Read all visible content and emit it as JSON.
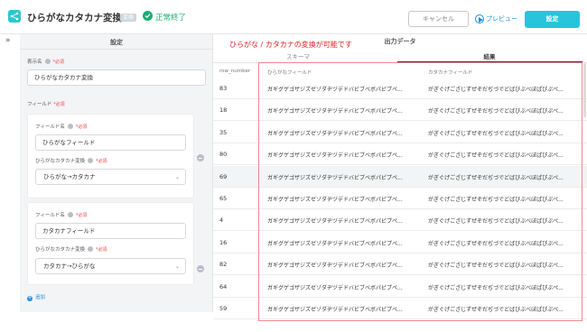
{
  "header": {
    "title": "ひらがなカタカナ変換",
    "badge": "変換",
    "status": "正常終了",
    "cancel_label": "キャンセル",
    "preview_label": "プレビュー",
    "save_label": "設定"
  },
  "colors": {
    "accent": "#28c4dc",
    "status_green": "#1aae73",
    "required_red": "#e84545",
    "annotation_red": "#e02020"
  },
  "settings": {
    "title": "設定",
    "display_name_label": "表示名",
    "required": "*必須",
    "display_name_value": "ひらがなカタカナ変換",
    "field_label": "フィールド",
    "add_label": "追加",
    "items": [
      {
        "field_name_label": "フィールド名",
        "field_name_value": "ひらがなフィールド",
        "conversion_label": "ひらがなカタカナ変換",
        "conversion_value": "ひらがな→カタカナ"
      },
      {
        "field_name_label": "フィールド名",
        "field_name_value": "カタカナフィールド",
        "conversion_label": "ひらがなカタカナ変換",
        "conversion_value": "カタカナ→ひらがな"
      }
    ]
  },
  "output": {
    "title": "出力データ",
    "annotation": "ひらがな / カタカナの変換が可能です",
    "tabs": [
      "スキーマ",
      "結果"
    ],
    "columns": [
      "row_number",
      "ひらがなフィールド",
      "カタカナフィールド"
    ],
    "rows": [
      {
        "num": "83",
        "a": "ガギグゲゴザジズゼゾダヂヅデドバビブベボパピプペ...",
        "b": "がぎぐげござじずぜぞだぢづでどばびぶべぼぱぴぷぺ..."
      },
      {
        "num": "18",
        "a": "ガギグゲゴザジズゼゾダヂヅデドバビブベボパピプペ...",
        "b": "がぎぐげござじずぜぞだぢづでどばびぶべぼぱぴぷぺ..."
      },
      {
        "num": "35",
        "a": "ガギグゲゴザジズゼゾダヂヅデドバビブベボパピプペ...",
        "b": "がぎぐげござじずぜぞだぢづでどばびぶべぼぱぴぷぺ..."
      },
      {
        "num": "80",
        "a": "ガギグゲゴザジズゼゾダヂヅデドバビブベボパピプペ...",
        "b": "がぎぐげござじずぜぞだぢづでどばびぶべぼぱぴぷぺ..."
      },
      {
        "num": "69",
        "a": "ガギグゲゴザジズゼゾダヂヅデドバビブベボパピプペ...",
        "b": "がぎぐげござじずぜぞだぢづでどばびぶべぼぱぴぷぺ..."
      },
      {
        "num": "65",
        "a": "ガギグゲゴザジズゼゾダヂヅデドバビブベボパピプペ...",
        "b": "がぎぐげござじずぜぞだぢづでどばびぶべぼぱぴぷぺ..."
      },
      {
        "num": "4",
        "a": "ガギグゲゴザジズゼゾダヂヅデドバビブベボパピプペ...",
        "b": "がぎぐげござじずぜぞだぢづでどばびぶべぼぱぴぷぺ..."
      },
      {
        "num": "16",
        "a": "ガギグゲゴザジズゼゾダヂヅデドバビブベボパピプペ...",
        "b": "がぎぐげござじずぜぞだぢづでどばびぶべぼぱぴぷぺ..."
      },
      {
        "num": "82",
        "a": "ガギグゲゴザジズゼゾダヂヅデドバビブベボパピプペ...",
        "b": "がぎぐげござじずぜぞだぢづでどばびぶべぼぱぴぷぺ..."
      },
      {
        "num": "64",
        "a": "ガギグゲゴザジズゼゾダヂヅデドバビブベボパピプペ...",
        "b": "がぎぐげござじずぜぞだぢづでどばびぶべぼぱぴぷぺ..."
      },
      {
        "num": "59",
        "a": "ガギグゲゴザジズゼゾダヂヅデドバビブベボパピプペ...",
        "b": "がぎぐげござじずぜぞだぢづでどばびぶべぼぱぴぷぺ..."
      }
    ]
  }
}
